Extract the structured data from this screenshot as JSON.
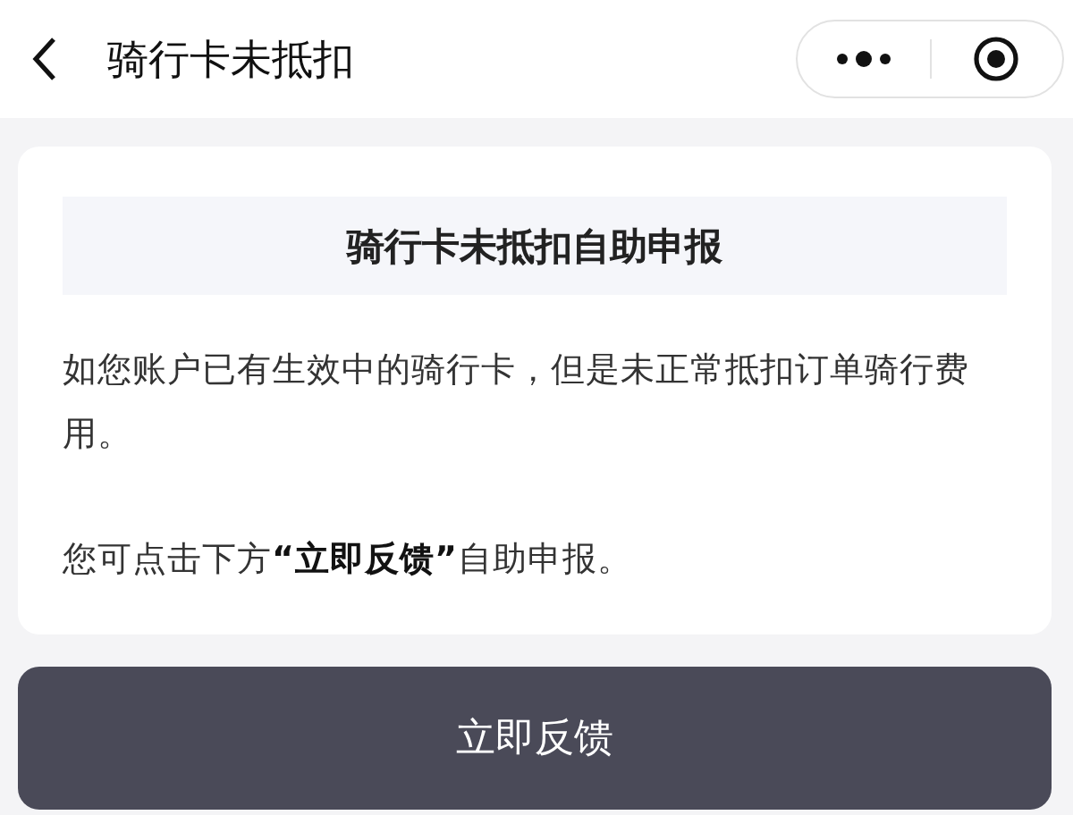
{
  "header": {
    "title": "骑行卡未抵扣"
  },
  "card": {
    "heading": "骑行卡未抵扣自助申报",
    "paragraphs": [
      "如您账户已有生效中的骑行卡，但是未正常抵扣订单骑行费用。",
      "您可点击下方**“立即反馈”**自助申报。"
    ]
  },
  "button": {
    "label": "立即反馈"
  }
}
